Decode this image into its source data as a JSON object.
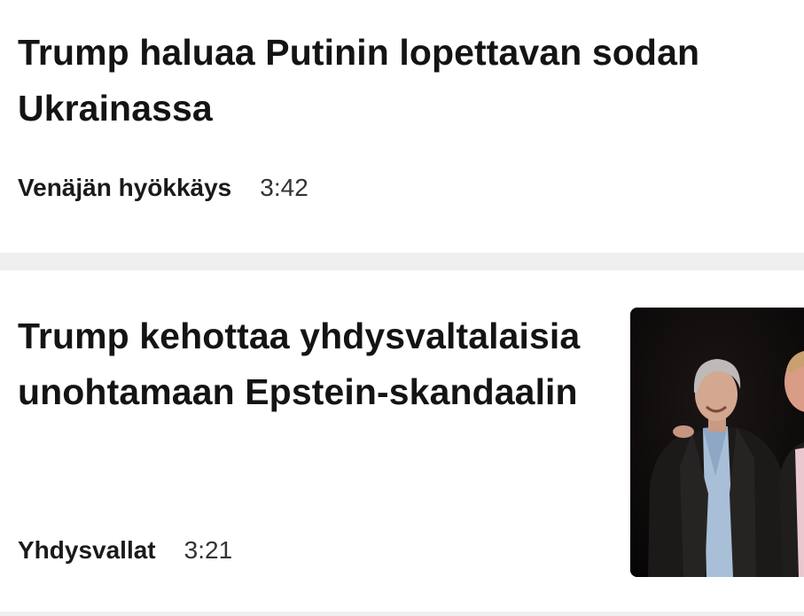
{
  "articles": [
    {
      "headline": "Trump haluaa Putinin lopettavan sodan Ukrainassa",
      "category": "Venäjän hyökkäys",
      "time": "3:42"
    },
    {
      "headline": "Trump kehottaa yhdysvaltalaisia unohtamaan Epstein-skandaalin",
      "category": "Yhdysvallat",
      "time": "3:21",
      "thumbnail": "photo of two men in suits"
    }
  ],
  "colors": {
    "background": "#ffffff",
    "separator": "#efeff0",
    "text": "#141414"
  }
}
